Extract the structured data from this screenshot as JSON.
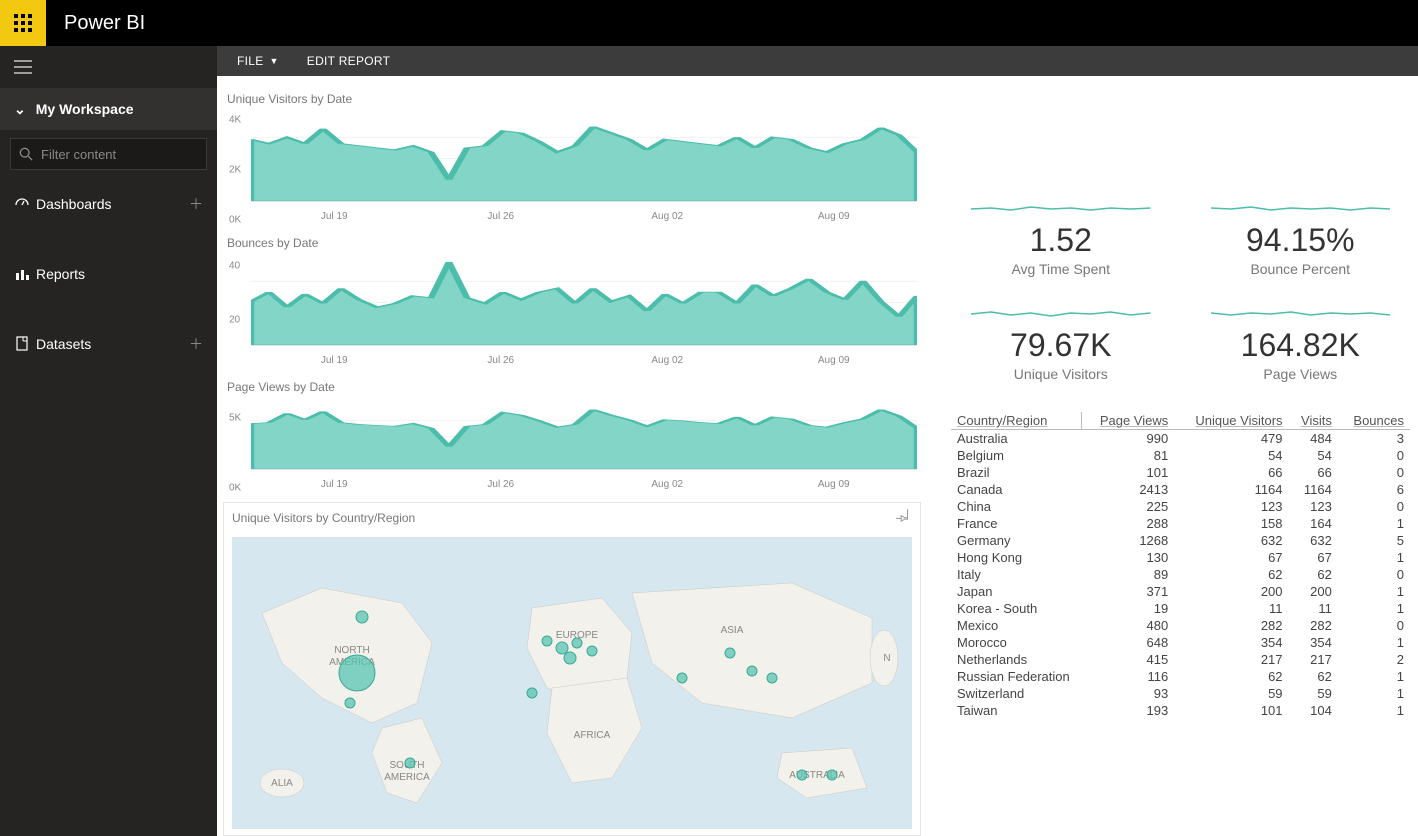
{
  "app": {
    "brand": "Power BI"
  },
  "sidebar": {
    "workspace": "My Workspace",
    "search_placeholder": "Filter content",
    "nav": {
      "dashboards": "Dashboards",
      "reports": "Reports",
      "datasets": "Datasets"
    }
  },
  "toolbar": {
    "file": "FILE",
    "edit": "EDIT REPORT"
  },
  "charts": {
    "visitors": {
      "title": "Unique Visitors by Date",
      "ymax": 4000,
      "yticks": [
        "4K",
        "2K",
        "0K"
      ],
      "xlabels": [
        "Jul 19",
        "Jul 26",
        "Aug 02",
        "Aug 09"
      ]
    },
    "bounces": {
      "title": "Bounces by Date",
      "ymax": 40,
      "yticks": [
        "40",
        "20"
      ],
      "xlabels": [
        "Jul 19",
        "Jul 26",
        "Aug 02",
        "Aug 09"
      ]
    },
    "pageviews": {
      "title": "Page Views by Date",
      "ymax": 6000,
      "yticks": [
        "5K",
        "0K"
      ],
      "xlabels": [
        "Jul 19",
        "Jul 26",
        "Aug 02",
        "Aug 09"
      ]
    },
    "map": {
      "title": "Unique Visitors by Country/Region"
    }
  },
  "kpis": {
    "avg_time": {
      "value": "1.52",
      "label": "Avg Time Spent"
    },
    "bounce_pct": {
      "value": "94.15%",
      "label": "Bounce Percent"
    },
    "unique": {
      "value": "79.67K",
      "label": "Unique Visitors"
    },
    "pageviews": {
      "value": "164.82K",
      "label": "Page Views"
    }
  },
  "table": {
    "headers": {
      "c": "Country/Region",
      "pv": "Page Views",
      "uv": "Unique Visitors",
      "v": "Visits",
      "b": "Bounces"
    },
    "rows": [
      {
        "c": "Australia",
        "pv": "990",
        "uv": "479",
        "v": "484",
        "b": "3"
      },
      {
        "c": "Belgium",
        "pv": "81",
        "uv": "54",
        "v": "54",
        "b": "0"
      },
      {
        "c": "Brazil",
        "pv": "101",
        "uv": "66",
        "v": "66",
        "b": "0"
      },
      {
        "c": "Canada",
        "pv": "2413",
        "uv": "1164",
        "v": "1164",
        "b": "6"
      },
      {
        "c": "China",
        "pv": "225",
        "uv": "123",
        "v": "123",
        "b": "0"
      },
      {
        "c": "France",
        "pv": "288",
        "uv": "158",
        "v": "164",
        "b": "1"
      },
      {
        "c": "Germany",
        "pv": "1268",
        "uv": "632",
        "v": "632",
        "b": "5"
      },
      {
        "c": "Hong Kong",
        "pv": "130",
        "uv": "67",
        "v": "67",
        "b": "1"
      },
      {
        "c": "Italy",
        "pv": "89",
        "uv": "62",
        "v": "62",
        "b": "0"
      },
      {
        "c": "Japan",
        "pv": "371",
        "uv": "200",
        "v": "200",
        "b": "1"
      },
      {
        "c": "Korea - South",
        "pv": "19",
        "uv": "11",
        "v": "11",
        "b": "1"
      },
      {
        "c": "Mexico",
        "pv": "480",
        "uv": "282",
        "v": "282",
        "b": "0"
      },
      {
        "c": "Morocco",
        "pv": "648",
        "uv": "354",
        "v": "354",
        "b": "1"
      },
      {
        "c": "Netherlands",
        "pv": "415",
        "uv": "217",
        "v": "217",
        "b": "2"
      },
      {
        "c": "Russian Federation",
        "pv": "116",
        "uv": "62",
        "v": "62",
        "b": "1"
      },
      {
        "c": "Switzerland",
        "pv": "93",
        "uv": "59",
        "v": "59",
        "b": "1"
      },
      {
        "c": "Taiwan",
        "pv": "193",
        "uv": "101",
        "v": "104",
        "b": "1"
      }
    ]
  },
  "chart_data": [
    {
      "type": "area",
      "title": "Unique Visitors by Date",
      "xlabel": "",
      "ylabel": "",
      "ylim": [
        0,
        4000
      ],
      "x_ticks": [
        "Jul 19",
        "Jul 26",
        "Aug 02",
        "Aug 09"
      ],
      "values": [
        2900,
        2700,
        3000,
        2700,
        3400,
        2700,
        2600,
        2500,
        2400,
        2600,
        2300,
        1000,
        2500,
        2600,
        3300,
        3200,
        2800,
        2300,
        2600,
        3500,
        3200,
        2900,
        2400,
        2900,
        2800,
        2700,
        2600,
        3000,
        2500,
        3000,
        2900,
        2500,
        2300,
        2700,
        2900,
        3450,
        3100,
        2300
      ]
    },
    {
      "type": "area",
      "title": "Bounces by Date",
      "xlabel": "",
      "ylabel": "",
      "ylim": [
        0,
        45
      ],
      "x_ticks": [
        "Jul 19",
        "Jul 26",
        "Aug 02",
        "Aug 09"
      ],
      "values": [
        23,
        28,
        20,
        27,
        22,
        30,
        24,
        20,
        22,
        26,
        25,
        44,
        25,
        22,
        28,
        24,
        28,
        30,
        22,
        30,
        23,
        26,
        18,
        27,
        22,
        28,
        28,
        22,
        32,
        26,
        30,
        35,
        28,
        24,
        34,
        23,
        15,
        26
      ]
    },
    {
      "type": "area",
      "title": "Page Views by Date",
      "xlabel": "",
      "ylabel": "",
      "ylim": [
        0,
        7000
      ],
      "x_ticks": [
        "Jul 19",
        "Jul 26",
        "Aug 02",
        "Aug 09"
      ],
      "values": [
        4900,
        5000,
        6000,
        5300,
        6200,
        5000,
        4800,
        4700,
        4600,
        4900,
        4400,
        2400,
        4600,
        4800,
        6100,
        5800,
        5200,
        4500,
        4800,
        6400,
        5800,
        5300,
        4600,
        5300,
        5200,
        5000,
        4900,
        5600,
        4700,
        5600,
        5400,
        4700,
        4500,
        5000,
        5400,
        6400,
        5700,
        4400
      ]
    }
  ]
}
